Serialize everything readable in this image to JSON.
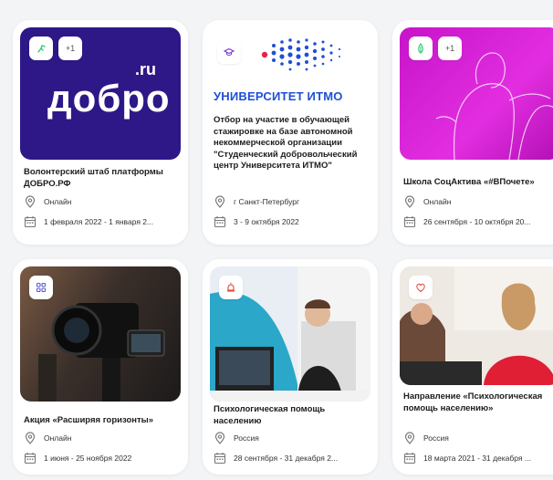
{
  "cards": [
    {
      "logo": {
        "big": "добро",
        "small": ".ru"
      },
      "chip_count": "+1",
      "title": "Волонтерский штаб платформы ДОБРО.РФ",
      "location": "Онлайн",
      "dates": "1 февраля 2022 - 1 января 2...",
      "icons": [
        "run-icon",
        "location-pin-icon",
        "calendar-icon"
      ],
      "accent": "#3b1f9c"
    },
    {
      "logo": {
        "text": "УНИВЕРСИТЕТ ИТМО"
      },
      "title": "Отбор на участие в обучающей стажировке на базе автономной некоммерческой организации \"Студенческий добровольческий центр Университета ИТМО\"",
      "location": "г Санкт-Петербург",
      "dates": "3 - 9 октября 2022",
      "icons": [
        "graduation-cap-icon",
        "location-pin-icon",
        "calendar-icon"
      ],
      "accent": "#1f4fd6"
    },
    {
      "chip_count": "+1",
      "title": "Школа СоцАктива «#ВПочете»",
      "location": "Онлайн",
      "dates": "26 сентября - 10 октября 20...",
      "icons": [
        "leaf-icon",
        "location-pin-icon",
        "calendar-icon"
      ],
      "accent": "#d61bd0"
    },
    {
      "title": "Акция «Расширяя горизонты»",
      "location": "Онлайн",
      "dates": "1 июня - 25 ноября 2022",
      "icons": [
        "grid-icon",
        "location-pin-icon",
        "calendar-icon"
      ]
    },
    {
      "title": "Психологическая помощь населению",
      "location": "Россия",
      "dates": "28 сентября - 31 декабря 2...",
      "icons": [
        "alarm-icon",
        "location-pin-icon",
        "calendar-icon"
      ]
    },
    {
      "title": "Направление «Психологическая помощь населению»",
      "location": "Россия",
      "dates": "18 марта 2021 - 31 декабря ...",
      "icons": [
        "heart-icon",
        "location-pin-icon",
        "calendar-icon"
      ]
    }
  ]
}
